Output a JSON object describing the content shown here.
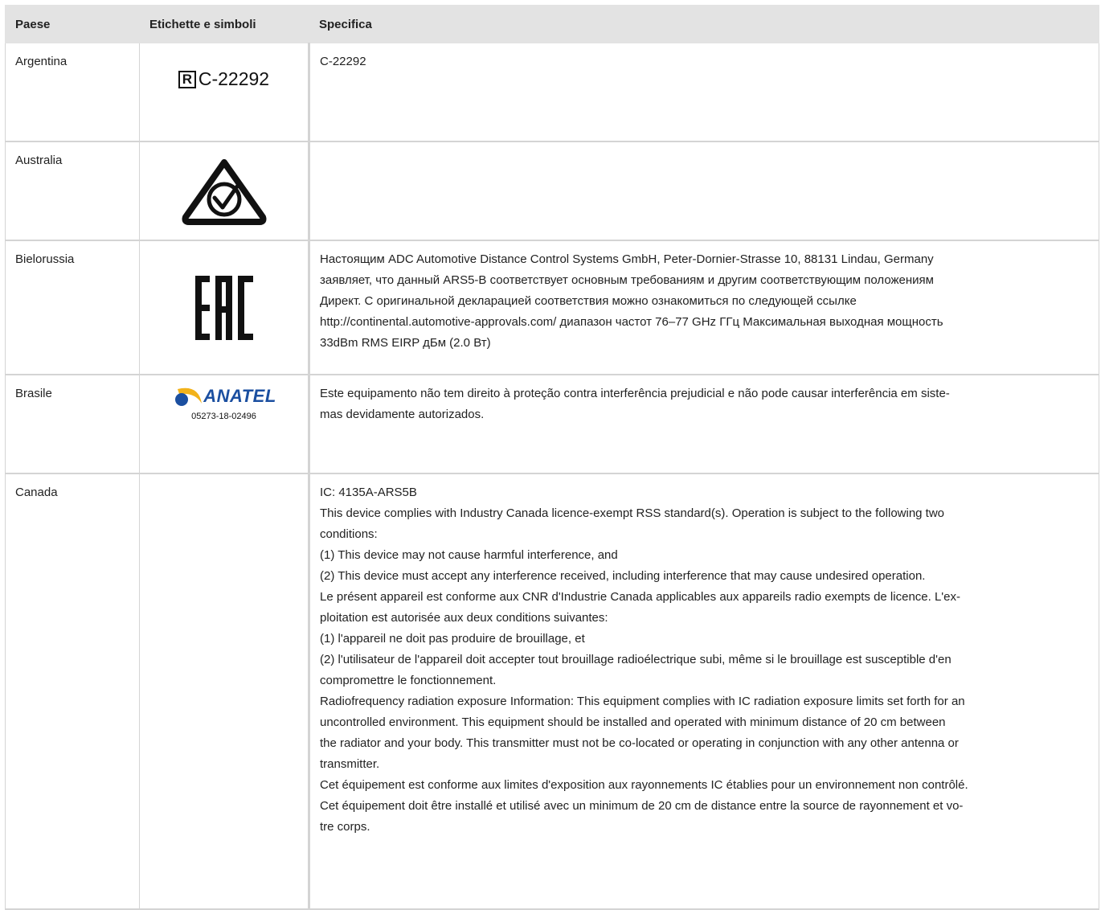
{
  "headers": {
    "country": "Paese",
    "symbols": "Etichette e simboli",
    "spec": "Specifica"
  },
  "rows": [
    {
      "country": "Argentina",
      "symbol_icon": "registered-mark-icon",
      "symbol_box_letter": "R",
      "symbol_text": "C-22292",
      "spec_lines": [
        "C-22292"
      ]
    },
    {
      "country": "Australia",
      "symbol_icon": "rcm-compliance-mark-icon",
      "spec_lines": []
    },
    {
      "country": "Bielorussia",
      "symbol_icon": "eac-mark-icon",
      "symbol_text": "EAC",
      "spec_lines": [
        "Настоящим ADC Automotive Distance Control Systems GmbH, Peter-Dornier-Strasse 10, 88131 Lindau, Germany",
        "заявляет, что данный ARS5-B соответствует основным требованиям и другим соответствующим положениям",
        "Директ. С оригинальной декларацией соответствия можно ознакомиться по следующей ссылке",
        "http://continental.automotive-approvals.com/ диапазон частот 76–77 GHz ГГц Максимальная выходная мощность",
        "33dBm RMS EIRP дБм (2.0 Вт)"
      ]
    },
    {
      "country": "Brasile",
      "symbol_icon": "anatel-logo-icon",
      "symbol_text": "ANATEL",
      "symbol_code": "05273-18-02496",
      "spec_lines": [
        "Este equipamento não tem direito à proteção contra interferência prejudicial e não pode causar interferência em siste-",
        "mas devidamente autorizados."
      ]
    },
    {
      "country": "Canada",
      "spec_lines": [
        "IC: 4135A-ARS5B",
        "This device complies with Industry Canada licence-exempt RSS standard(s). Operation is subject to the following two",
        "conditions:",
        "(1) This device may not cause harmful interference, and",
        "(2) This device must accept any interference received, including interference that may cause undesired operation.",
        "Le présent appareil est conforme aux CNR d'Industrie Canada applicables aux appareils radio exempts de licence. L'ex-",
        "ploitation est autorisée aux deux conditions suivantes:",
        "(1) l'appareil ne doit pas produire de brouillage, et",
        "(2) l'utilisateur de l'appareil doit accepter tout brouillage radioélectrique subi, même si le brouillage est susceptible d'en",
        "compromettre le fonctionnement.",
        "Radiofrequency radiation exposure Information: This equipment complies with IC radiation exposure limits set forth for an",
        "uncontrolled environment. This equipment should be installed and operated with minimum distance of 20 cm between",
        "the radiator and your body. This transmitter must not be co-located or operating in conjunction with any other antenna or",
        "transmitter.",
        "Cet équipement est conforme aux limites d'exposition aux rayonnements IC établies pour un environnement non contrôlé.",
        "Cet équipement doit être installé et utilisé avec un minimum de 20 cm de distance entre la source de rayonnement et vo-",
        "tre corps."
      ]
    }
  ]
}
